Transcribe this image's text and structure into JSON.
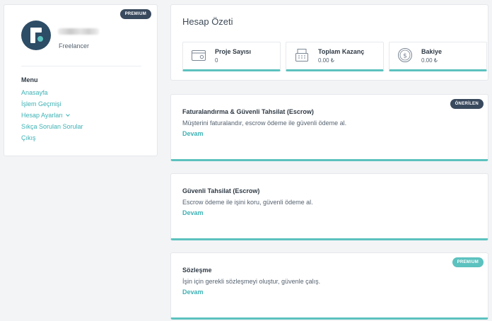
{
  "sidebar": {
    "badge": "PREMIUM",
    "user_role": "Freelancer",
    "menu_title": "Menu",
    "menu_items": [
      {
        "label": "Anasayfa"
      },
      {
        "label": "İşlem Geçmişi"
      },
      {
        "label": "Hesap Ayarları",
        "has_chevron": true
      },
      {
        "label": "Sıkça Sorulan Sorular"
      },
      {
        "label": "Çıkış"
      }
    ]
  },
  "summary": {
    "title": "Hesap Özeti",
    "stats": [
      {
        "label": "Proje Sayısı",
        "value": "0",
        "icon": "wallet-icon"
      },
      {
        "label": "Toplam Kazanç",
        "value": "0.00 ₺",
        "icon": "cash-register-icon"
      },
      {
        "label": "Bakiye",
        "value": "0.00 ₺",
        "icon": "coin-icon"
      }
    ]
  },
  "features": [
    {
      "title": "Faturalandırma & Güvenli Tahsilat (Escrow)",
      "description": "Müşterini faturalandır, escrow ödeme ile güvenli ödeme al.",
      "link": "Devam",
      "badge": "ÖNERİLEN"
    },
    {
      "title": "Güvenli Tahsilat (Escrow)",
      "description": "Escrow ödeme ile işini koru, güvenli ödeme al.",
      "link": "Devam"
    },
    {
      "title": "Sözleşme",
      "description": "İşin için gerekli sözleşmeyi oluştur, güvenle çalış.",
      "link": "Devam",
      "badge": "PREMIUM"
    }
  ],
  "colors": {
    "accent": "#5cc2bf",
    "link": "#3fb2b5",
    "badge_dark": "#3a4a5e",
    "avatar_bg": "#2d4c66"
  }
}
